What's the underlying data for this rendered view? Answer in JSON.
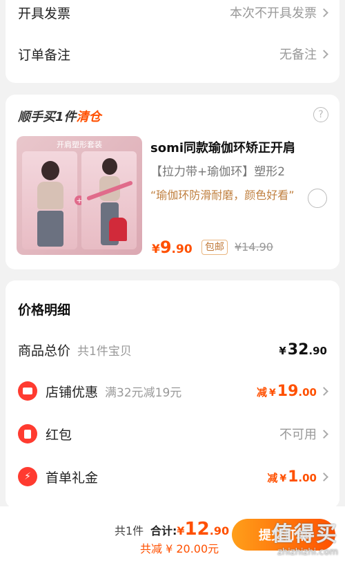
{
  "invoice": {
    "label": "开具发票",
    "value": "本次不开具发票"
  },
  "remark": {
    "label": "订单备注",
    "value": "无备注"
  },
  "addon": {
    "title_prefix": "顺手买1件",
    "title_suffix": "清仓",
    "help": "?",
    "image_banner": "开肩塑形套装",
    "image_plus": "+",
    "product_title": "somi同款瑜伽环矫正开肩",
    "sku": "【拉力带+瑜伽环】塑形2",
    "desc": "“瑜伽环防滑耐磨，颜色好看”",
    "price_currency": "¥",
    "price_int": "9",
    "price_dec": ".90",
    "free_shipping": "包邮",
    "original_price": "¥14.90"
  },
  "price_detail": {
    "title": "价格明细",
    "goods_total_label": "商品总价",
    "goods_total_sub": "共1件宝贝",
    "goods_total_cur": "¥",
    "goods_total_int": "32",
    "goods_total_dec": ".90",
    "shop_discount_label": "店铺优惠",
    "shop_discount_sub": "满32元减19元",
    "shop_discount_prefix": "减",
    "shop_discount_cur": "¥",
    "shop_discount_int": "19",
    "shop_discount_dec": ".00",
    "redpacket_label": "红包",
    "redpacket_value": "不可用",
    "first_gift_label": "首单礼金",
    "first_gift_prefix": "减",
    "first_gift_cur": "¥",
    "first_gift_int": "1",
    "first_gift_dec": ".00"
  },
  "bottom": {
    "count": "共1件",
    "total_label": "合计:",
    "total_cur": "¥",
    "total_int": "12",
    "total_dec": ".90",
    "saved": "共减 ¥ 20.00元",
    "submit_label": "提交订单"
  },
  "watermark": {
    "big": "值得买",
    "small": "zhizhizhi.com"
  },
  "colors": {
    "accent": "#ff5000",
    "icon_red": "#ff3b30",
    "background": "#f2f2f2"
  }
}
